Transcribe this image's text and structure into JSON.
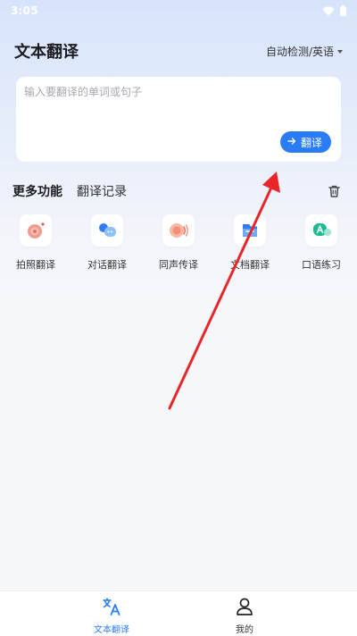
{
  "status_bar": {
    "time": "3:05",
    "icons": [
      "wifi-icon",
      "battery-icon"
    ]
  },
  "header": {
    "title": "文本翻译",
    "language_selector": "自动检测/英语"
  },
  "input_card": {
    "placeholder": "输入要翻译的单词或句子",
    "value": "",
    "translate_button": "翻译"
  },
  "tabs": [
    {
      "label": "更多功能",
      "active": true
    },
    {
      "label": "翻译记录",
      "active": false
    }
  ],
  "features": [
    {
      "label": "拍照翻译",
      "icon": "photo-translate-icon"
    },
    {
      "label": "对话翻译",
      "icon": "dialogue-translate-icon"
    },
    {
      "label": "同声传译",
      "icon": "simultaneous-interpretation-icon"
    },
    {
      "label": "文档翻译",
      "icon": "document-translate-icon"
    },
    {
      "label": "口语练习",
      "icon": "speaking-practice-icon"
    }
  ],
  "bottom_nav": [
    {
      "label": "文本翻译",
      "icon": "translate-icon",
      "active": true
    },
    {
      "label": "我的",
      "icon": "user-icon",
      "active": false
    }
  ],
  "colors": {
    "accent": "#2a7cf6",
    "annotation_arrow": "#e8262a"
  }
}
